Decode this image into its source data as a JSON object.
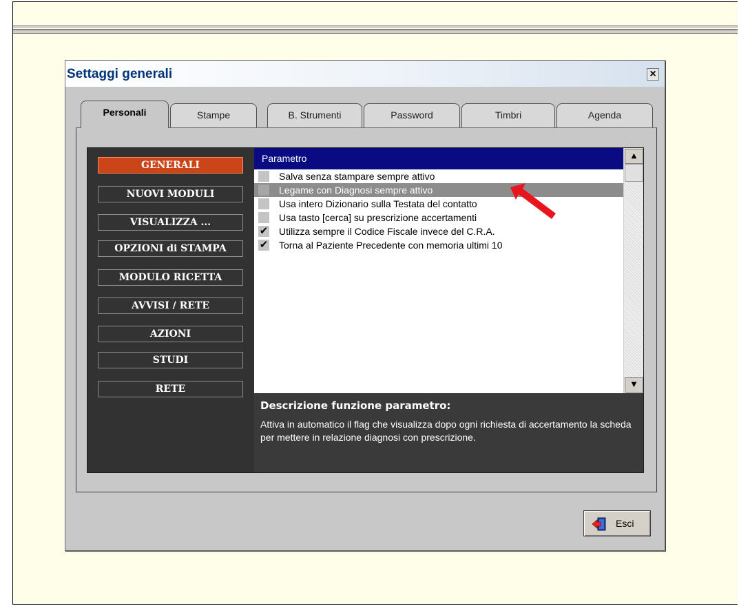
{
  "dialog": {
    "title": "Settaggi generali",
    "close_glyph": "×"
  },
  "tabs": [
    {
      "label": "Personali",
      "active": true
    },
    {
      "label": "Stampe",
      "active": false
    },
    {
      "label": "B. Strumenti",
      "active": false
    },
    {
      "label": "Password",
      "active": false
    },
    {
      "label": "Timbri",
      "active": false
    },
    {
      "label": "Agenda",
      "active": false
    }
  ],
  "categories": [
    {
      "label": "GENERALI",
      "active": true
    },
    {
      "label": "NUOVI MODULI",
      "active": false
    },
    {
      "label": "VISUALIZZA ...",
      "active": false
    },
    {
      "label": "OPZIONI di STAMPA",
      "active": false
    },
    {
      "label": "MODULO RICETTA",
      "active": false
    },
    {
      "label": "AVVISI / RETE",
      "active": false
    },
    {
      "label": "AZIONI",
      "active": false
    },
    {
      "label": "STUDI",
      "active": false
    },
    {
      "label": "RETE",
      "active": false
    }
  ],
  "params": {
    "header": "Parametro",
    "rows": [
      {
        "label": "Salva senza stampare sempre attivo",
        "checked": false,
        "selected": false
      },
      {
        "label": "Legame con Diagnosi sempre attivo",
        "checked": false,
        "selected": true
      },
      {
        "label": "Usa intero Dizionario sulla Testata del contatto",
        "checked": false,
        "selected": false
      },
      {
        "label": "Usa tasto [cerca] su prescrizione accertamenti",
        "checked": false,
        "selected": false
      },
      {
        "label": "Utilizza sempre il Codice Fiscale invece del C.R.A.",
        "checked": true,
        "selected": false
      },
      {
        "label": "Torna al Paziente Precedente con memoria ultimi 10",
        "checked": true,
        "selected": false
      }
    ],
    "check_glyph": "✔"
  },
  "scroll": {
    "up_glyph": "▲",
    "down_glyph": "▼"
  },
  "description": {
    "title": "Descrizione funzione parametro:",
    "text": "Attiva in automatico il flag che visualizza dopo ogni richiesta di accertamento la scheda per mettere in relazione diagnosi con prescrizione."
  },
  "exit_button": {
    "label": "Esci",
    "icon": "exit-door-icon"
  },
  "colors": {
    "title_text": "#00337a",
    "header_bg": "#0a0a82",
    "active_category": "#cc4518",
    "annotation_arrow": "#e8141e"
  }
}
